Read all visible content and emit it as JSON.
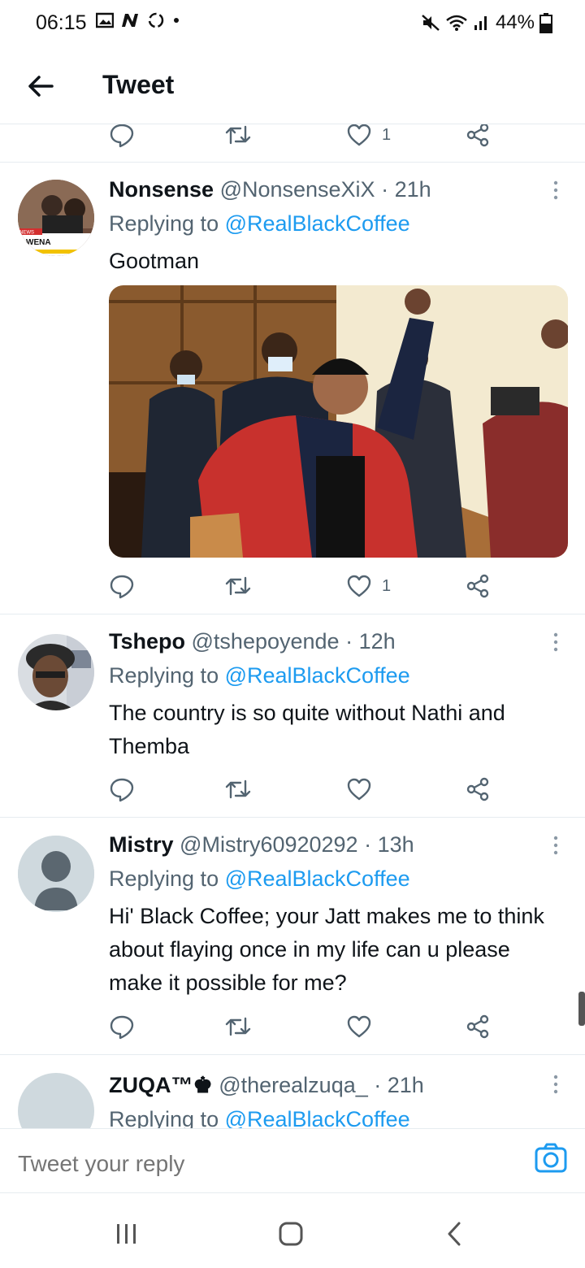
{
  "status": {
    "time": "06:15",
    "battery": "44%"
  },
  "header": {
    "title": "Tweet"
  },
  "top_actions": {
    "like_count": "1"
  },
  "tweets": [
    {
      "name": "Nonsense",
      "handle": "@NonsenseXiX",
      "time": "· 21h",
      "replying_prefix": "Replying to ",
      "replying_to": "@RealBlackCoffee",
      "text": "Gootman",
      "avatar_text": {
        "tag": "NEWS",
        "label": "WENA"
      },
      "like_count": "1"
    },
    {
      "name": "Tshepo",
      "handle": "@tshepoyende",
      "time": "· 12h",
      "replying_prefix": "Replying to ",
      "replying_to": "@RealBlackCoffee",
      "text": "The country is so quite without Nathi and Themba",
      "like_count": ""
    },
    {
      "name": "Mistry",
      "handle": "@Mistry60920292",
      "time": "· 13h",
      "replying_prefix": "Replying to ",
      "replying_to": "@RealBlackCoffee",
      "text": "Hi' Black Coffee; your Jatt makes me to think about flaying once in my life can u please make it possible for me?",
      "like_count": ""
    },
    {
      "name": "ZUQA™♚",
      "handle": "@therealzuqa_",
      "time": "· 21h",
      "replying_prefix": "Replying to ",
      "replying_to": "@RealBlackCoffee"
    }
  ],
  "reply_bar": {
    "placeholder": "Tweet your reply"
  },
  "colors": {
    "accent": "#1d9bf0",
    "secondary_text": "#536471",
    "divider": "#e6ecf0"
  },
  "icons": [
    "back-arrow-icon",
    "reply-icon",
    "retweet-icon",
    "like-icon",
    "share-icon",
    "more-icon",
    "camera-icon",
    "recents-icon",
    "home-icon",
    "back-icon"
  ]
}
